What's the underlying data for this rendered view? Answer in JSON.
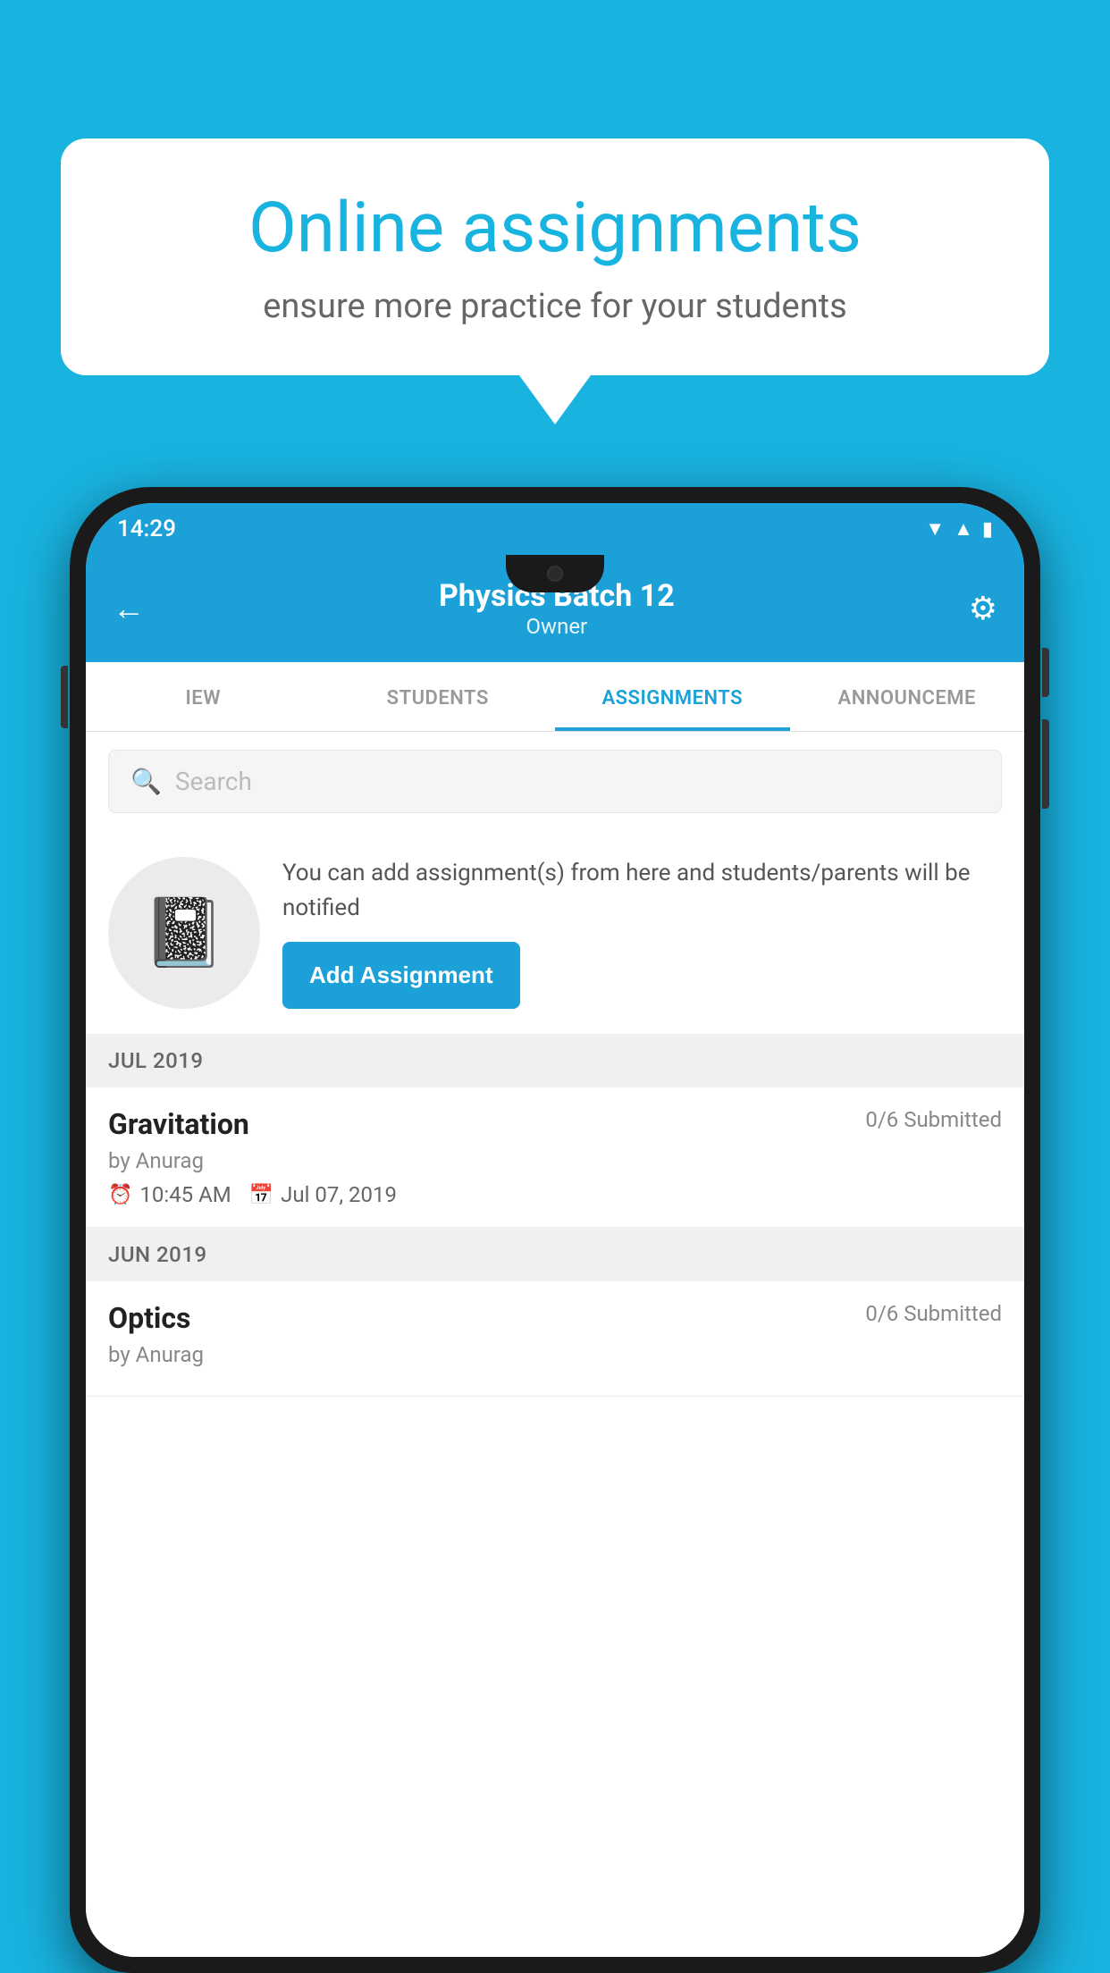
{
  "background_color": "#19B3E0",
  "speech_bubble": {
    "title": "Online assignments",
    "subtitle": "ensure more practice for your students"
  },
  "status_bar": {
    "time": "14:29"
  },
  "app_header": {
    "title": "Physics Batch 12",
    "subtitle": "Owner",
    "back_icon": "←",
    "settings_icon": "⚙"
  },
  "tabs": [
    {
      "label": "IEW",
      "active": false
    },
    {
      "label": "STUDENTS",
      "active": false
    },
    {
      "label": "ASSIGNMENTS",
      "active": true
    },
    {
      "label": "ANNOUNCEME",
      "active": false
    }
  ],
  "search": {
    "placeholder": "Search"
  },
  "promo": {
    "description_text": "You can add assignment(s) from here and students/parents will be notified",
    "button_label": "Add Assignment"
  },
  "sections": [
    {
      "header": "JUL 2019",
      "assignments": [
        {
          "title": "Gravitation",
          "submitted": "0/6 Submitted",
          "author": "by Anurag",
          "time": "10:45 AM",
          "date": "Jul 07, 2019"
        }
      ]
    },
    {
      "header": "JUN 2019",
      "assignments": [
        {
          "title": "Optics",
          "submitted": "0/6 Submitted",
          "author": "by Anurag",
          "time": "",
          "date": ""
        }
      ]
    }
  ]
}
